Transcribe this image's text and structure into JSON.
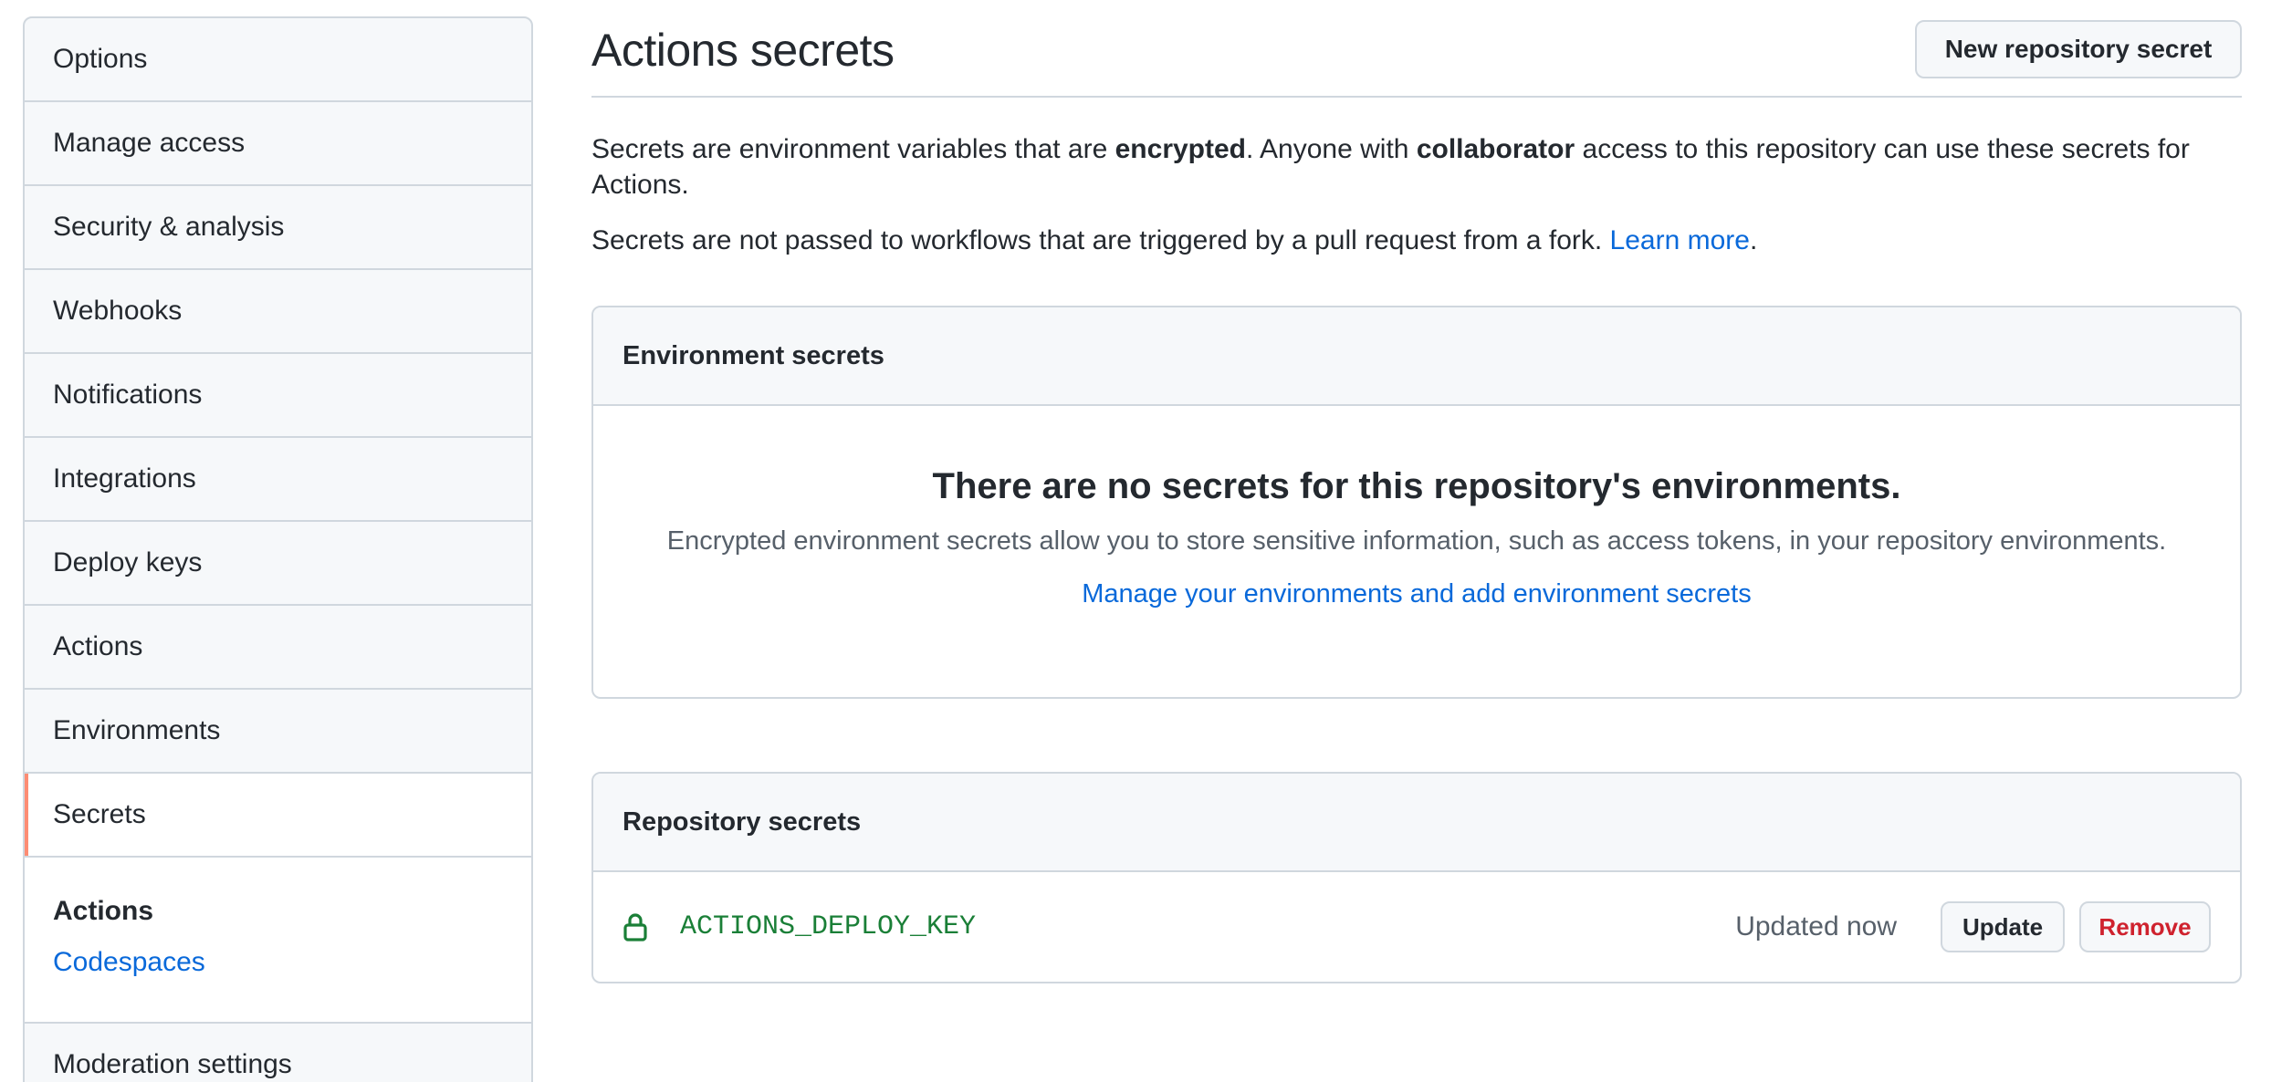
{
  "sidebar": {
    "items": [
      {
        "label": "Options"
      },
      {
        "label": "Manage access"
      },
      {
        "label": "Security & analysis"
      },
      {
        "label": "Webhooks"
      },
      {
        "label": "Notifications"
      },
      {
        "label": "Integrations"
      },
      {
        "label": "Deploy keys"
      },
      {
        "label": "Actions"
      },
      {
        "label": "Environments"
      },
      {
        "label": "Secrets",
        "selected": true
      }
    ],
    "group": {
      "heading": "Actions",
      "link": "Codespaces"
    },
    "moderation": "Moderation settings"
  },
  "header": {
    "title": "Actions secrets",
    "new_secret_label": "New repository secret"
  },
  "description": {
    "line1_part1": "Secrets are environment variables that are ",
    "line1_bold1": "encrypted",
    "line1_part2": ". Anyone with ",
    "line1_bold2": "collaborator",
    "line1_part3": " access to this repository can use these secrets for Actions.",
    "line2_text": "Secrets are not passed to workflows that are triggered by a pull request from a fork. ",
    "line2_link": "Learn more",
    "line2_end": "."
  },
  "environment_secrets": {
    "header": "Environment secrets",
    "blank_title": "There are no secrets for this repository's environments.",
    "blank_desc": "Encrypted environment secrets allow you to store sensitive information, such as access tokens, in your repository environments.",
    "blank_link": "Manage your environments and add environment secrets"
  },
  "repository_secrets": {
    "header": "Repository secrets",
    "rows": [
      {
        "icon": "lock-icon",
        "name": "ACTIONS_DEPLOY_KEY",
        "updated": "Updated now",
        "update_label": "Update",
        "remove_label": "Remove"
      }
    ]
  },
  "colors": {
    "accent_link": "#0969da",
    "secret_name": "#1a7f37",
    "danger": "#cf222e",
    "selected_marker": "#fd8c73",
    "border": "#d0d7de"
  }
}
